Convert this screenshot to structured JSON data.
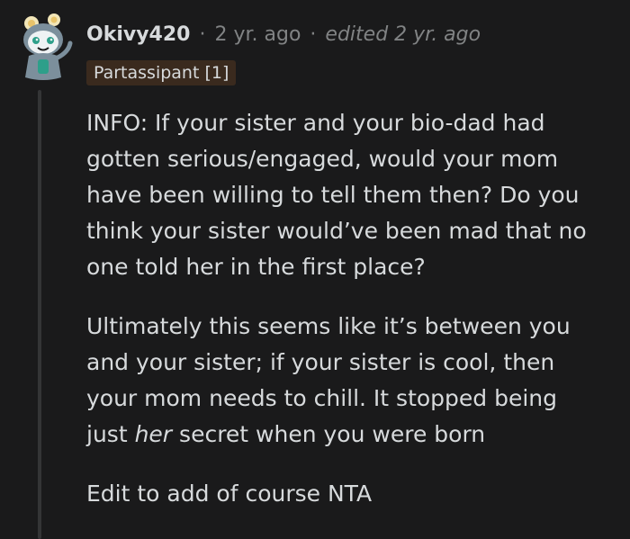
{
  "comment": {
    "username": "Okivy420",
    "separator": "·",
    "time": "2 yr. ago",
    "edited": "edited 2 yr. ago",
    "flair": "Partassipant [1]",
    "paragraphs": [
      {
        "lines": [
          "INFO: If your sister and your bio-dad had",
          "gotten serious/engaged, would your mom",
          "have been willing to tell them then? Do you",
          "think your sister would’ve been mad that no",
          "one told her in the first place?"
        ]
      },
      {
        "lines": [
          "Ultimately this seems like it’s between you",
          "and your sister; if your sister is cool, then",
          "your mom needs to chill. It stopped being"
        ],
        "last_line": {
          "before": "just ",
          "emphasis": "her",
          "after": " secret when you were born"
        }
      },
      {
        "lines": [
          "Edit to add of course NTA"
        ]
      }
    ]
  },
  "colors": {
    "background": "#1a1a1b",
    "text": "#d7dadc",
    "muted": "#818384",
    "flair_bg": "#3a2a1e",
    "thread_line": "#343536"
  },
  "icons": {
    "avatar": "snoo-avatar-icon"
  }
}
